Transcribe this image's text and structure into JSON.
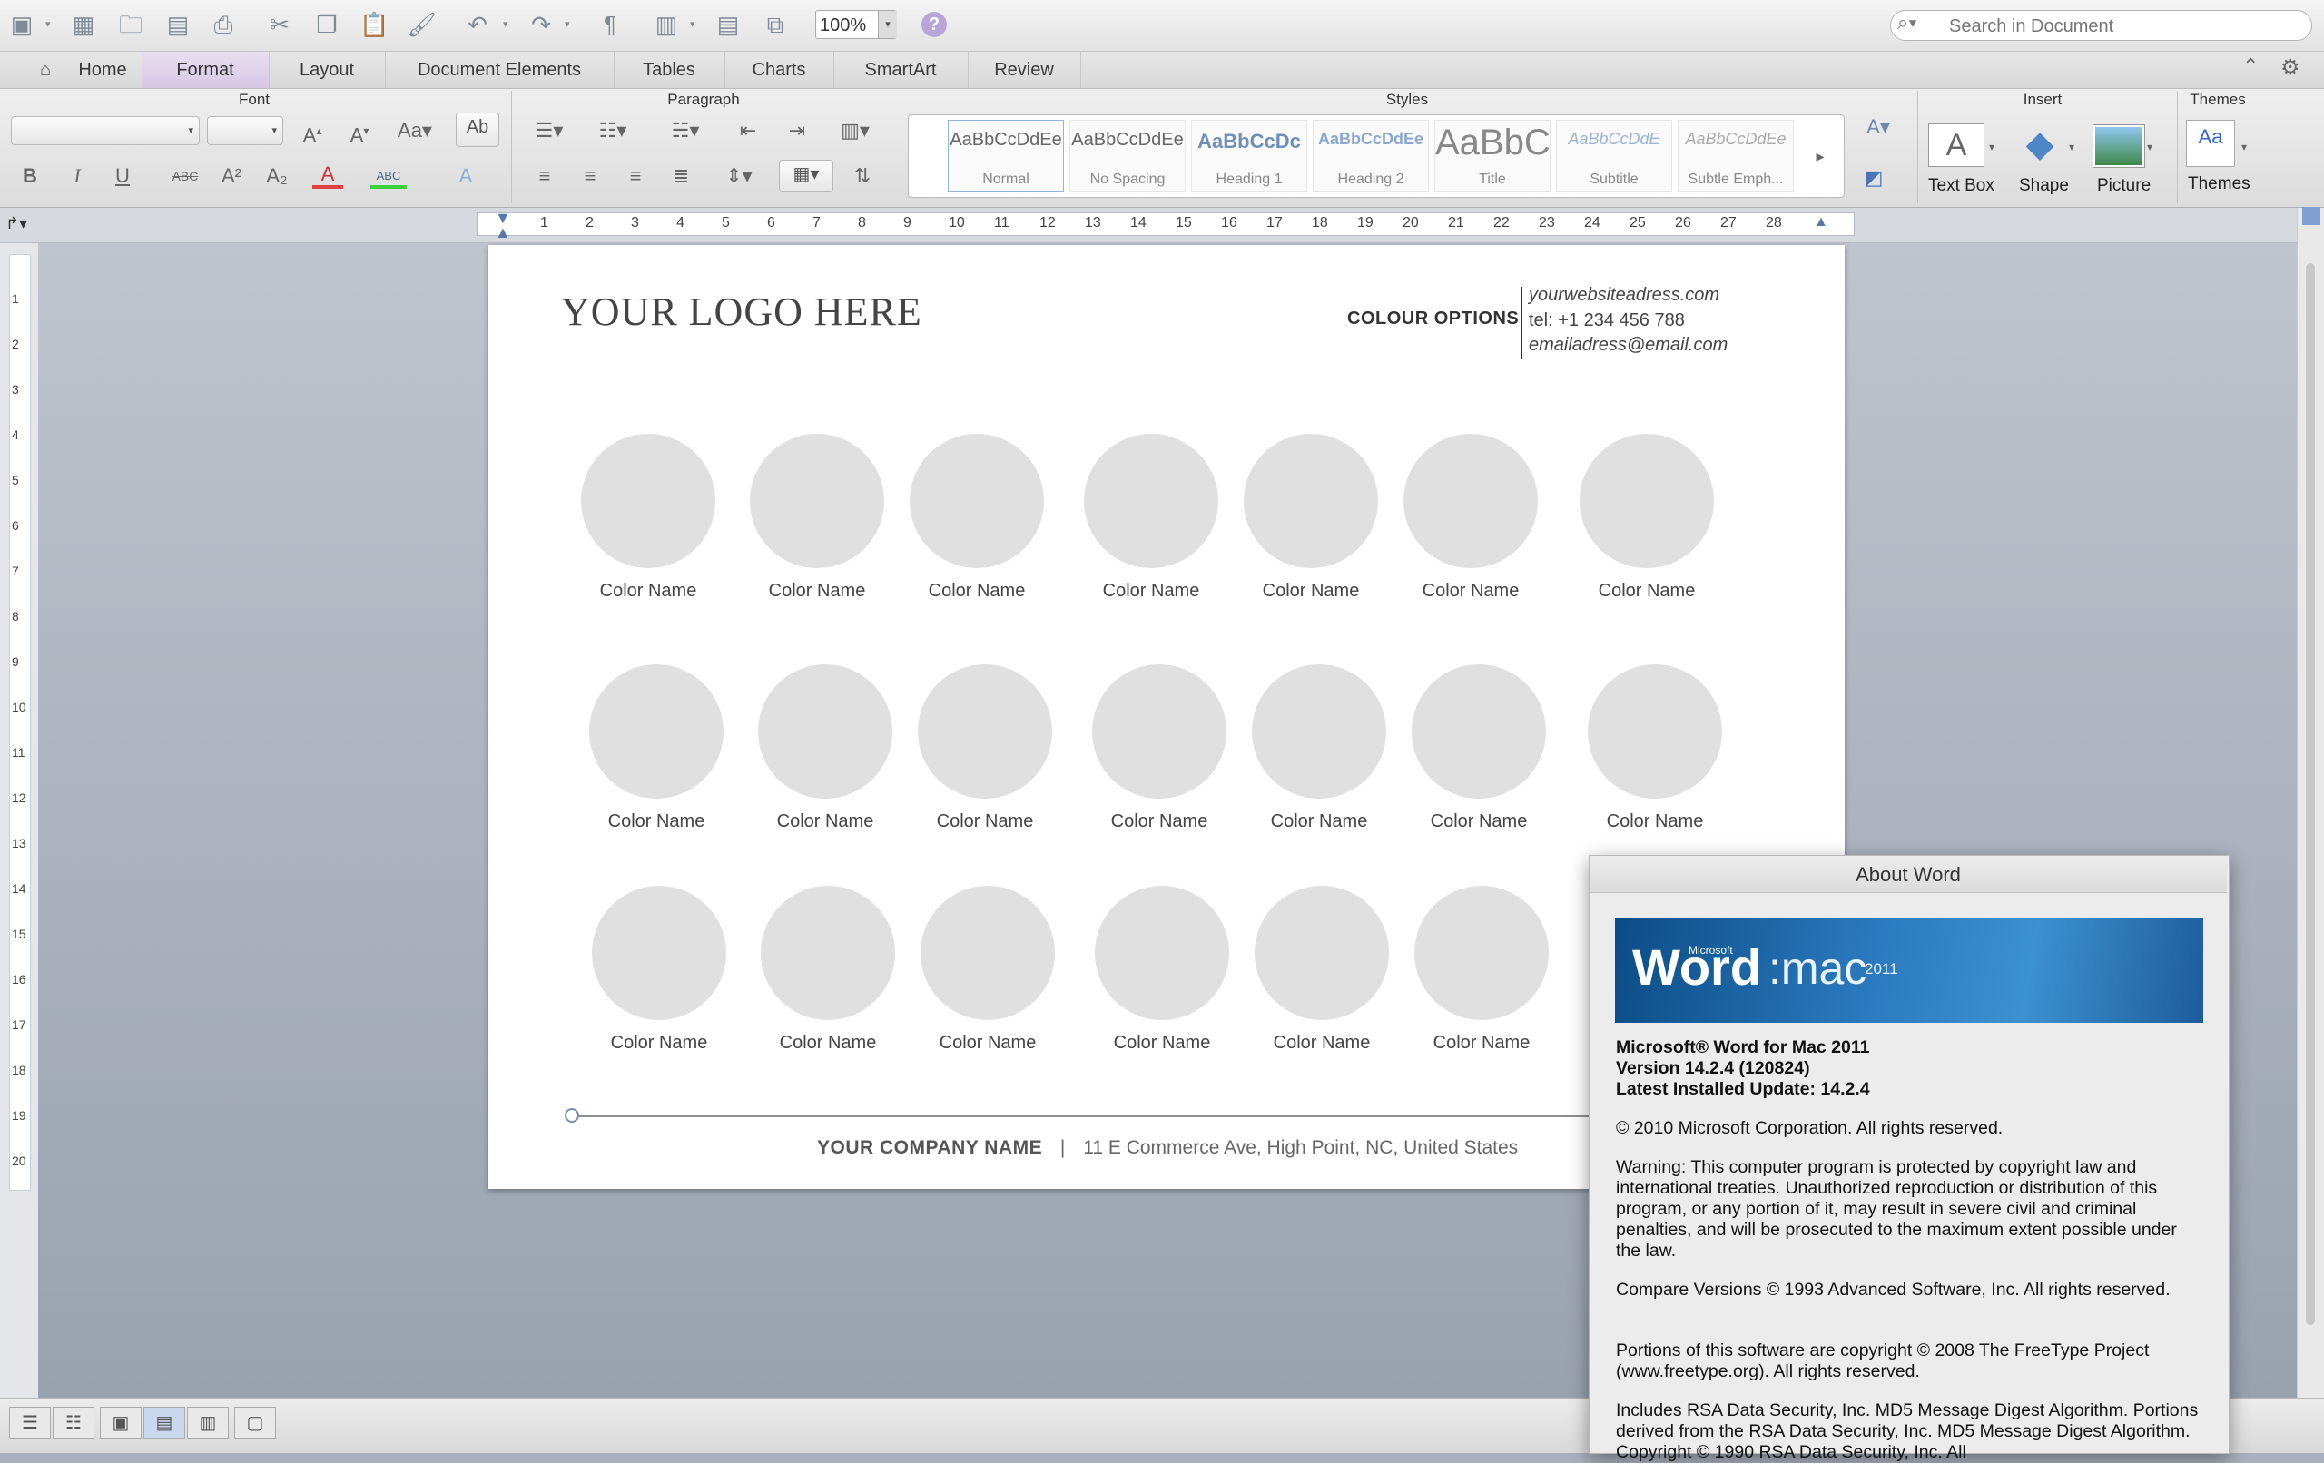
{
  "toolbar": {
    "zoom": "100%",
    "search_placeholder": "Search in Document"
  },
  "tabs": [
    "Home",
    "Format",
    "Layout",
    "Document Elements",
    "Tables",
    "Charts",
    "SmartArt",
    "Review"
  ],
  "ribbon": {
    "groups": {
      "font": "Font",
      "paragraph": "Paragraph",
      "styles": "Styles",
      "insert": "Insert",
      "themes": "Themes"
    },
    "styles": [
      {
        "sample": "AaBbCcDdEe",
        "label": "Normal"
      },
      {
        "sample": "AaBbCcDdEe",
        "label": "No Spacing"
      },
      {
        "sample": "AaBbCcDc",
        "label": "Heading 1"
      },
      {
        "sample": "AaBbCcDdEe",
        "label": "Heading 2"
      },
      {
        "sample": "AaBbC",
        "label": "Title"
      },
      {
        "sample": "AaBbCcDdE",
        "label": "Subtitle"
      },
      {
        "sample": "AaBbCcDdEe",
        "label": "Subtle Emph..."
      }
    ],
    "insert": {
      "text_box": "Text Box",
      "shape": "Shape",
      "picture": "Picture"
    },
    "themes_label": "Themes"
  },
  "ruler": {
    "h_numbers": [
      "1",
      "2",
      "3",
      "4",
      "5",
      "6",
      "7",
      "8",
      "9",
      "10",
      "11",
      "12",
      "13",
      "14",
      "15",
      "16",
      "17",
      "18",
      "19",
      "20",
      "21",
      "22",
      "23",
      "24",
      "25",
      "26",
      "27",
      "28"
    ],
    "v_numbers": [
      "1",
      "2",
      "3",
      "4",
      "5",
      "6",
      "7",
      "8",
      "9",
      "10",
      "11",
      "12",
      "13",
      "14",
      "15",
      "16",
      "17",
      "18",
      "19",
      "20"
    ]
  },
  "document": {
    "logo": "YOUR LOGO HERE",
    "colour_options": "COLOUR OPTIONS",
    "website": "yourwebsiteadress.com",
    "tel": "tel: +1 234 456 788",
    "email": "emailadress@email.com",
    "swatch_label": "Color Name",
    "footer_company": "YOUR COMPANY NAME",
    "footer_separator": "|",
    "footer_address": "11 E Commerce Ave, High Point, NC, United States"
  },
  "about": {
    "title": "About Word",
    "banner_word": "Word",
    "banner_microsoft": "Microsoft",
    "banner_mac": ":mac",
    "banner_year": "2011",
    "product": "Microsoft® Word for Mac 2011",
    "version": "Version 14.2.4 (120824)",
    "latest_update": "Latest Installed Update: 14.2.4",
    "copyright": "© 2010 Microsoft Corporation. All rights reserved.",
    "warning": "Warning: This computer program is protected by copyright law and international treaties.  Unauthorized reproduction or distribution of this program, or any portion of it, may result in severe civil and criminal penalties, and will be prosecuted to the maximum extent possible under the law.",
    "compare": "Compare Versions © 1993 Advanced Software, Inc.  All rights reserved.",
    "freetype": "Portions of this software are copyright © 2008 The FreeType Project (www.freetype.org).  All rights reserved.",
    "rsa": "Includes RSA Data Security, Inc. MD5 Message Digest Algorithm. Portions derived from the RSA Data Security, Inc. MD5 Message Digest Algorithm.  Copyright © 1990 RSA Data Security, Inc. All"
  }
}
